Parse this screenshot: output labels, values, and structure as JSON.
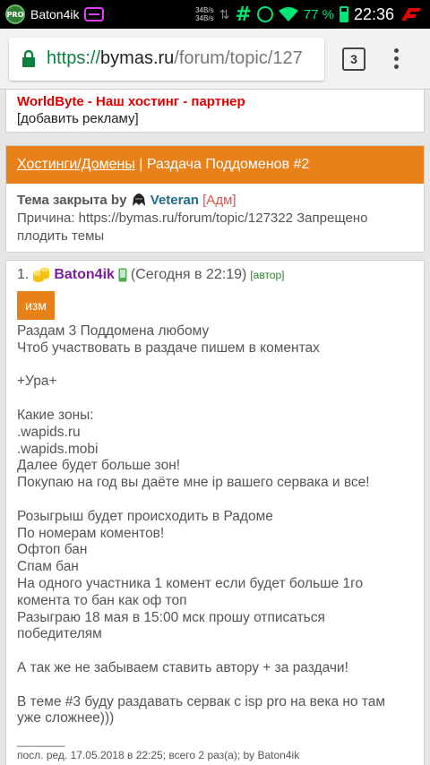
{
  "status_bar": {
    "pro_badge": "PRO",
    "app_name": "Baton4ik",
    "net_speed_top": "34B/s",
    "net_speed_bottom": "34B/s",
    "battery_percent": "77 %",
    "time": "22:36",
    "accent_green": "#00e676"
  },
  "browser": {
    "url_scheme": "https://",
    "url_host": "bymas.ru",
    "url_path": "/forum/topic/127",
    "tab_count": "3"
  },
  "ad": {
    "link_text": "WorldByte - Наш хостинг - партнер",
    "add_text": "[добавить рекламу]"
  },
  "topic": {
    "category": "Хостинги/Домены",
    "separator": " | ",
    "title": "Раздача Поддоменов #2",
    "closed_label": "Тема закрыта by",
    "closed_by": "Veteran",
    "closed_role": "[Адм]",
    "reason": "Причина: https://bymas.ru/forum/topic/127322 Запрещено плодить темы",
    "header_color": "#e8811a"
  },
  "post": {
    "number": "1.",
    "author": "Baton4ik",
    "time": "(Сегодня в 22:19)",
    "author_tag": "[автор]",
    "edit_label": "изм",
    "text": "Раздам 3 Поддомена любому\nЧтоб участвовать в раздаче пишем в коментах\n\n+Ура+\n\nКакие зоны:\n.wapids.ru\n.wapids.mobi\nДалее будет больше зон!\nПокупаю на год вы даёте мне ip вашего сервака и все!\n\nРозыгрыш будет происходить в Радоме\nПо номерам коментов!\nОфтоп бан\nСпам бан\nНа одного участника 1 комент если будет больше 1го\nкомента то бан как оф топ\nРазыграю 18 мая в 15:00 мск прошу отписаться\nпобедителям\n\nА так же не забываем ставить автору + за раздачи!\n\nВ теме #3 буду раздавать сервак с isp pro на века но там\nуже сложнее)))",
    "separator": "________",
    "footer": "посл. ред. 17.05.2018 в 22:25; всего 2 раз(а); by Baton4ik"
  }
}
